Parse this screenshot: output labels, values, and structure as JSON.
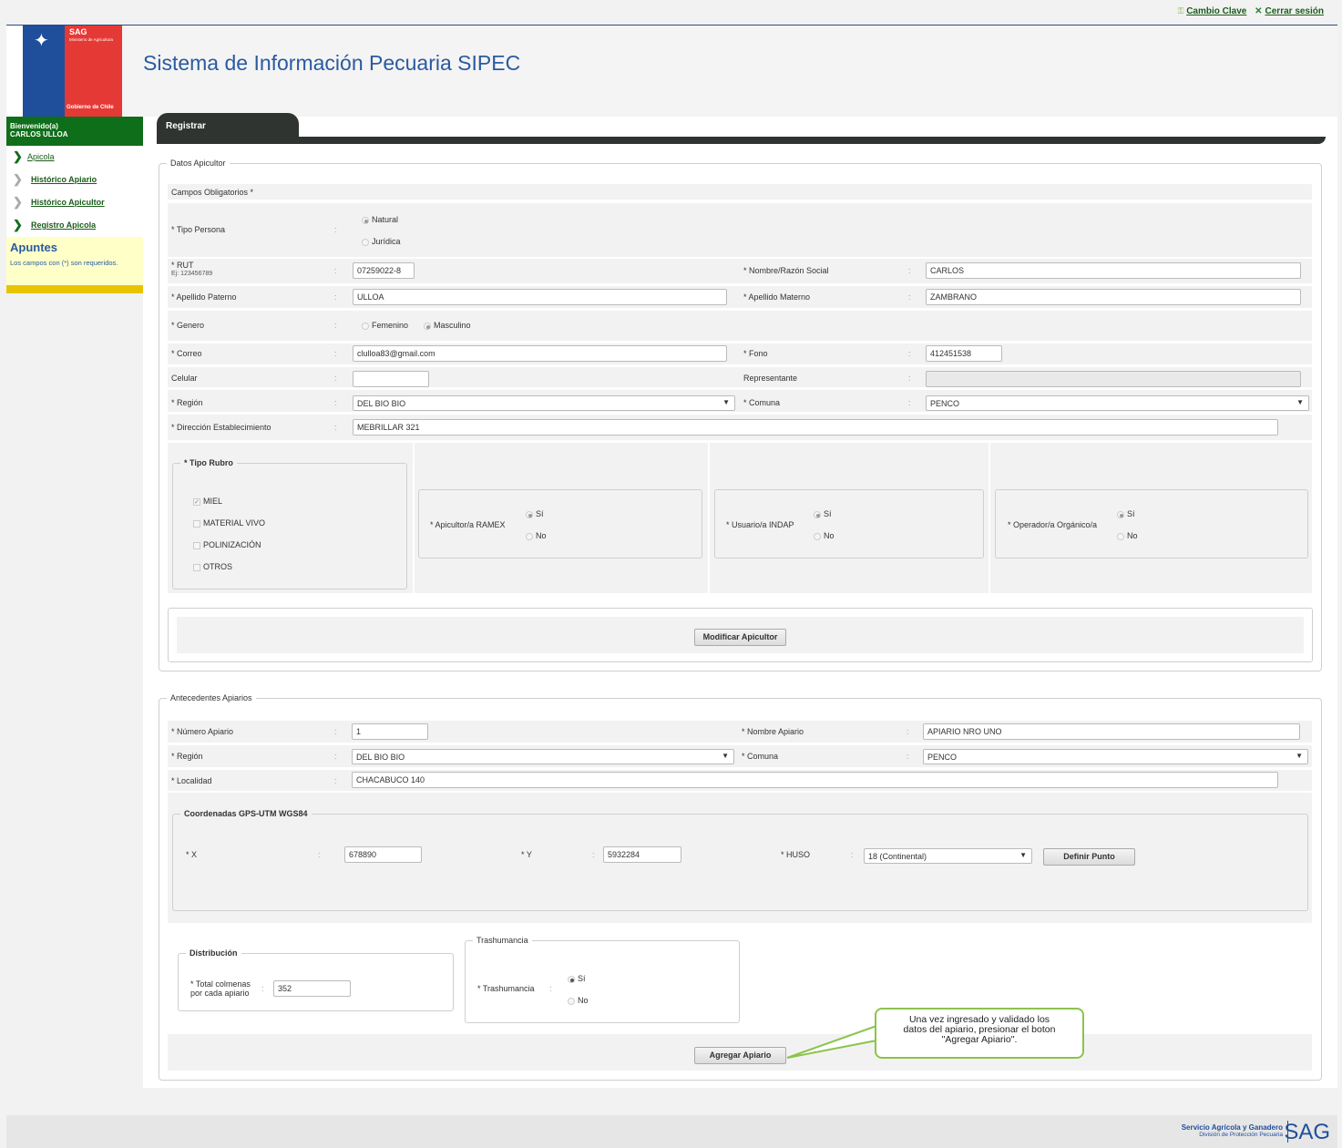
{
  "toplinks": {
    "change_password": "Cambio Clave",
    "logout": "Cerrar sesión"
  },
  "header": {
    "title": "Sistema de Información Pecuaria SIPEC",
    "logo": {
      "sag": "SAG",
      "ministry": "Ministerio de Agricultura",
      "government": "Gobierno de Chile"
    }
  },
  "sidebar": {
    "welcome_line1": "Bienvenido(a)",
    "welcome_line2": "CARLOS ULLOA",
    "items": [
      {
        "label": "Apicola"
      },
      {
        "label": "Histórico Apiario"
      },
      {
        "label": "Histórico Apicultor"
      },
      {
        "label": "Registro Apicola"
      }
    ],
    "notes_title": "Apuntes",
    "notes_text": "Los campos con (*) son requeridos."
  },
  "tab": {
    "label": "Registrar"
  },
  "apicultor": {
    "legend": "Datos Apicultor",
    "required_note": "Campos Obligatorios *",
    "tipo_persona": {
      "label": "* Tipo Persona",
      "opt1": "Natural",
      "opt2": "Jurídica"
    },
    "rut": {
      "label": "* RUT",
      "hint": "Ej: 123456789",
      "value": "07259022-8"
    },
    "nombre": {
      "label": "* Nombre/Razón Social",
      "value": "CARLOS"
    },
    "ap_paterno": {
      "label": "* Apellido Paterno",
      "value": "ULLOA"
    },
    "ap_materno": {
      "label": "* Apellido Materno",
      "value": "ZAMBRANO"
    },
    "genero": {
      "label": "* Genero",
      "opt1": "Femenino",
      "opt2": "Masculino"
    },
    "correo": {
      "label": "* Correo",
      "value": "clulloa83@gmail.com"
    },
    "fono": {
      "label": "* Fono",
      "value": "412451538"
    },
    "celular": {
      "label": "Celular",
      "value": ""
    },
    "representante": {
      "label": "Representante",
      "value": ""
    },
    "region": {
      "label": "* Región",
      "value": "DEL BIO BIO"
    },
    "comuna": {
      "label": "* Comuna",
      "value": "PENCO"
    },
    "direccion": {
      "label": "* Dirección Establecimiento",
      "value": "MEBRILLAR 321"
    },
    "rubro": {
      "legend": "* Tipo Rubro",
      "items": [
        "MIEL",
        "MATERIAL VIVO",
        "POLINIZACIÓN",
        "OTROS"
      ]
    },
    "ramex": {
      "label": "* Apicultor/a RAMEX",
      "yes": "Sí",
      "no": "No"
    },
    "indap": {
      "label": "* Usuario/a INDAP",
      "yes": "Sí",
      "no": "No"
    },
    "organico": {
      "label": "* Operador/a Orgánico/a",
      "yes": "Sí",
      "no": "No"
    },
    "modify_button": "Modificar Apicultor"
  },
  "apiario": {
    "legend": "Antecedentes Apiarios",
    "numero": {
      "label": "* Número Apiario",
      "value": "1"
    },
    "nombre": {
      "label": "* Nombre Apiario",
      "value": "APIARIO NRO UNO"
    },
    "region": {
      "label": "* Región",
      "value": "DEL BIO BIO"
    },
    "comuna": {
      "label": "* Comuna",
      "value": "PENCO"
    },
    "localidad": {
      "label": "* Localidad",
      "value": "CHACABUCO 140"
    },
    "coords": {
      "legend": "Coordenadas GPS-UTM WGS84",
      "x_label": "* X",
      "x_value": "678890",
      "y_label": "* Y",
      "y_value": "5932284",
      "huso_label": "* HUSO",
      "huso_value": "18 (Continental)",
      "define_button": "Definir Punto"
    },
    "distribucion": {
      "legend": "Distribución",
      "label_line1": "* Total colmenas",
      "label_line2": "por cada apiario",
      "value": "352"
    },
    "trashumancia": {
      "legend": "Trashumancia",
      "label": "* Trashumancia",
      "yes": "Sí",
      "no": "No"
    },
    "add_button": "Agregar Apiario"
  },
  "callout": {
    "line1": "Una vez ingresado y validado los",
    "line2": "datos del apiario, presionar el boton",
    "line3": "\"Agregar Apiario\"."
  },
  "footer": {
    "org": "Servicio Agrícola y Ganadero",
    "division": "División de Protección Pecuaria",
    "logo": "SAG"
  },
  "colors": {
    "brand_green": "#0f6e1a",
    "brand_blue": "#1f4e9b",
    "brand_red": "#e53935",
    "tab_dark": "#2f3430",
    "notes_bg": "#ffffc8",
    "callout_border": "#8bc34a"
  }
}
